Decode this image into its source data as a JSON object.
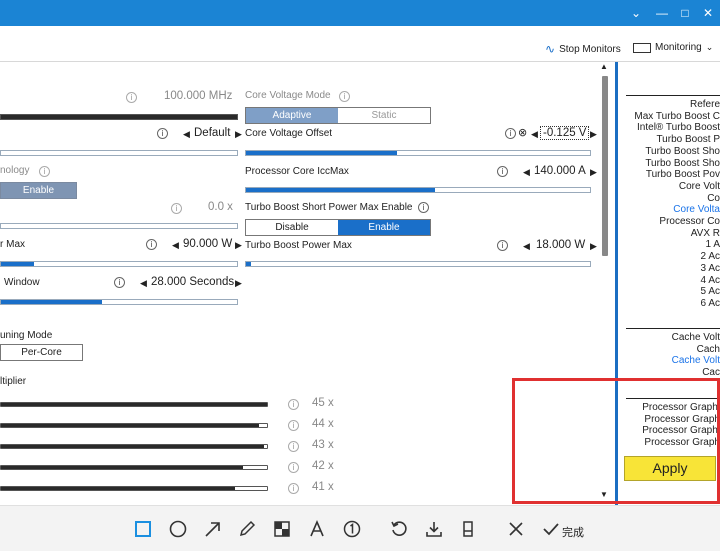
{
  "toolbar": {
    "stop_monitors": "Stop Monitors",
    "monitoring": "Monitoring"
  },
  "left": {
    "freq_value": "100.000 MHz",
    "default_value": "Default",
    "technology_label": "nology",
    "enable_label": "Enable",
    "zero_value": "0.0 x",
    "max_label": "r Max",
    "max_value": "90.000 W",
    "window_label": "Window",
    "window_value": "28.000 Seconds",
    "tuning_mode_label": "uning Mode",
    "per_core": "Per-Core",
    "multiplier_label": "ltiplier",
    "multipliers": [
      "45 x",
      "44 x",
      "43 x",
      "42 x",
      "41 x"
    ],
    "multiplier_levels": [
      1.0,
      0.97,
      0.99,
      0.91,
      0.88
    ]
  },
  "mid": {
    "core_voltage_mode": "Core Voltage Mode",
    "adaptive": "Adaptive",
    "static": "Static",
    "core_voltage_offset": "Core Voltage Offset",
    "offset_value": "-0.125 V",
    "iccmax_label": "Processor Core IccMax",
    "iccmax_value": "140.000 A",
    "short_power_enable": "Turbo Boost Short Power Max Enable",
    "disable": "Disable",
    "enable": "Enable",
    "power_max_label": "Turbo Boost Power Max",
    "power_max_value": "18.000 W"
  },
  "right": {
    "rows_a": [
      "Refere",
      "Max Turbo Boost C",
      "Intel® Turbo Boost",
      "Turbo Boost P",
      "Turbo Boost Sho",
      "Turbo Boost Sho",
      "Turbo Boost Pov",
      "Core Volt",
      "Co",
      "Core Volta",
      "Processor Co",
      "AVX R",
      "1 A",
      "2 Ac",
      "3 Ac",
      "4 Ac",
      "5 Ac",
      "6 Ac"
    ],
    "rows_b": [
      "Cache Volt",
      "Cach",
      "Cache Volt",
      "Cac"
    ],
    "rows_c": [
      "Processor Graphi",
      "Processor Graph",
      "Processor Graphi",
      "Processor Graph"
    ]
  },
  "apply_label": "Apply",
  "bottom": {
    "done_label": "完成"
  }
}
